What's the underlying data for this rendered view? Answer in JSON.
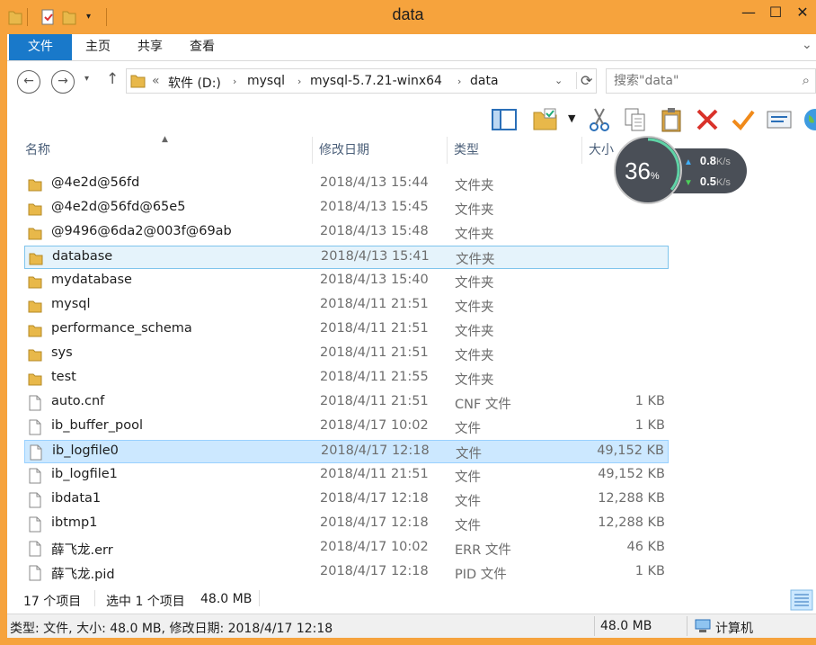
{
  "window": {
    "title": "data"
  },
  "ribbon": {
    "tabs": [
      "文件",
      "主页",
      "共享",
      "查看"
    ]
  },
  "address": {
    "overflow": "«",
    "crumbs": [
      "软件 (D:)",
      "mysql",
      "mysql-5.7.21-winx64",
      "data"
    ],
    "search_placeholder": "搜索\"data\""
  },
  "columns": {
    "name": "名称",
    "date": "修改日期",
    "type": "类型",
    "size": "大小"
  },
  "files": [
    {
      "name": "@4e2d@56fd",
      "date": "2018/4/13 15:44",
      "type": "文件夹",
      "size": "",
      "kind": "folder"
    },
    {
      "name": "@4e2d@56fd@65e5",
      "date": "2018/4/13 15:45",
      "type": "文件夹",
      "size": "",
      "kind": "folder"
    },
    {
      "name": "@9496@6da2@003f@69ab",
      "date": "2018/4/13 15:48",
      "type": "文件夹",
      "size": "",
      "kind": "folder"
    },
    {
      "name": "database",
      "date": "2018/4/13 15:41",
      "type": "文件夹",
      "size": "",
      "kind": "folder",
      "state": "hover"
    },
    {
      "name": "mydatabase",
      "date": "2018/4/13 15:40",
      "type": "文件夹",
      "size": "",
      "kind": "folder"
    },
    {
      "name": "mysql",
      "date": "2018/4/11 21:51",
      "type": "文件夹",
      "size": "",
      "kind": "folder"
    },
    {
      "name": "performance_schema",
      "date": "2018/4/11 21:51",
      "type": "文件夹",
      "size": "",
      "kind": "folder"
    },
    {
      "name": "sys",
      "date": "2018/4/11 21:51",
      "type": "文件夹",
      "size": "",
      "kind": "folder"
    },
    {
      "name": "test",
      "date": "2018/4/11 21:55",
      "type": "文件夹",
      "size": "",
      "kind": "folder"
    },
    {
      "name": "auto.cnf",
      "date": "2018/4/11 21:51",
      "type": "CNF 文件",
      "size": "1 KB",
      "kind": "file"
    },
    {
      "name": "ib_buffer_pool",
      "date": "2018/4/17 10:02",
      "type": "文件",
      "size": "1 KB",
      "kind": "file"
    },
    {
      "name": "ib_logfile0",
      "date": "2018/4/17 12:18",
      "type": "文件",
      "size": "49,152 KB",
      "kind": "file",
      "state": "selected"
    },
    {
      "name": "ib_logfile1",
      "date": "2018/4/11 21:51",
      "type": "文件",
      "size": "49,152 KB",
      "kind": "file"
    },
    {
      "name": "ibdata1",
      "date": "2018/4/17 12:18",
      "type": "文件",
      "size": "12,288 KB",
      "kind": "file"
    },
    {
      "name": "ibtmp1",
      "date": "2018/4/17 12:18",
      "type": "文件",
      "size": "12,288 KB",
      "kind": "file"
    },
    {
      "name": "薛飞龙.err",
      "date": "2018/4/17 10:02",
      "type": "ERR 文件",
      "size": "46 KB",
      "kind": "file"
    },
    {
      "name": "薛飞龙.pid",
      "date": "2018/4/17 12:18",
      "type": "PID 文件",
      "size": "1 KB",
      "kind": "file"
    }
  ],
  "status": {
    "count": "17 个项目",
    "selection": "选中 1 个项目",
    "selection_size": "48.0 MB",
    "details": "类型: 文件, 大小: 48.0 MB, 修改日期: 2018/4/17 12:18",
    "size": "48.0 MB",
    "location": "计算机"
  },
  "net_widget": {
    "cpu_percent": "36",
    "percent_sign": "%",
    "upload": "0.8",
    "download": "0.5",
    "unit": "K/s"
  },
  "colors": {
    "accent": "#1979ca",
    "frame": "#f6a33d",
    "folder": "#e8b84a"
  }
}
